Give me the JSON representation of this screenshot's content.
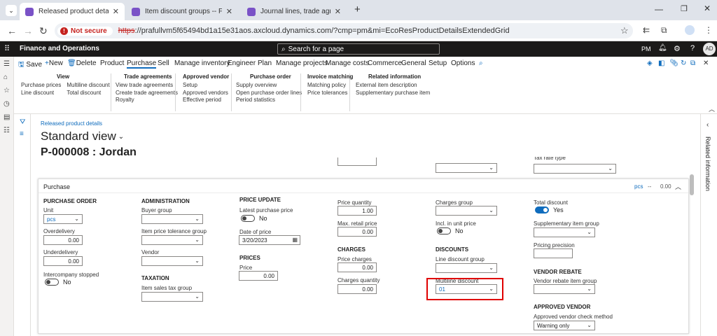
{
  "browser": {
    "tabs": [
      {
        "title": "Released product details -- Finance"
      },
      {
        "title": "Item discount groups -- Finance"
      },
      {
        "title": "Journal lines, trade agreement"
      }
    ],
    "new_tab": "+",
    "not_secure": "Not secure",
    "url_scheme": "https",
    "url_rest": "://prafullvm5f65494bd1a15e31aos.axcloud.dynamics.com/?cmp=pm&mi=EcoResProductDetailsExtendedGrid"
  },
  "app": {
    "title": "Finance and Operations",
    "search_placeholder": "Search for a page",
    "company": "PM",
    "avatar": "AD"
  },
  "commands": {
    "save": "Save",
    "new": "New",
    "delete": "Delete",
    "tabs": [
      "Product",
      "Purchase",
      "Sell",
      "Manage inventory",
      "Engineer",
      "Plan",
      "Manage projects",
      "Manage costs",
      "Commerce",
      "General",
      "Setup",
      "Options"
    ]
  },
  "ribbon": {
    "view": {
      "title": "View",
      "col1": [
        "Purchase prices",
        "Line discount"
      ],
      "col2": [
        "Multiline discount",
        "Total discount"
      ]
    },
    "trade": {
      "title": "Trade agreements",
      "items": [
        "View trade agreements",
        "Create trade agreements",
        "Royalty"
      ]
    },
    "vendor": {
      "title": "Approved vendor",
      "items": [
        "Setup",
        "Approved vendors",
        "Effective period"
      ]
    },
    "order": {
      "title": "Purchase order",
      "items": [
        "Supply overview",
        "Open purchase order lines",
        "Period statistics"
      ]
    },
    "matching": {
      "title": "Invoice matching",
      "items": [
        "Matching policy",
        "Price tolerances"
      ]
    },
    "related": {
      "title": "Related information",
      "items": [
        "External item description",
        "Supplementary purchase item"
      ]
    }
  },
  "page": {
    "breadcrumb": "Released product details",
    "view_name": "Standard view",
    "record_title": "P-000008 : Jordan",
    "related_pane": "Related information",
    "partial_label": "Tax rate type"
  },
  "purchase": {
    "title": "Purchase",
    "summary_unit": "pcs",
    "summary_sep": "--",
    "summary_price": "0.00",
    "purchase_order": {
      "section": "PURCHASE ORDER",
      "unit_label": "Unit",
      "unit_value": "pcs",
      "overdelivery_label": "Overdelivery",
      "overdelivery_value": "0.00",
      "underdelivery_label": "Underdelivery",
      "underdelivery_value": "0.00",
      "intercompany_label": "Intercompany stopped",
      "intercompany_value": "No"
    },
    "administration": {
      "section": "ADMINISTRATION",
      "buyer_group_label": "Buyer group",
      "tolerance_label": "Item price tolerance group",
      "vendor_label": "Vendor"
    },
    "taxation": {
      "section": "TAXATION",
      "sales_tax_label": "Item sales tax group"
    },
    "price_update": {
      "section": "PRICE UPDATE",
      "latest_label": "Latest purchase price",
      "latest_value": "No",
      "date_label": "Date of price",
      "date_value": "3/20/2023"
    },
    "prices": {
      "section": "PRICES",
      "price_label": "Price",
      "price_value": "0.00"
    },
    "quantity": {
      "price_qty_label": "Price quantity",
      "price_qty_value": "1.00",
      "max_retail_label": "Max. retail price",
      "max_retail_value": "0.00"
    },
    "charges": {
      "section": "CHARGES",
      "price_charges_label": "Price charges",
      "price_charges_value": "0.00",
      "charges_qty_label": "Charges quantity",
      "charges_qty_value": "0.00"
    },
    "charges_group": {
      "label": "Charges group",
      "incl_label": "Incl. in unit price",
      "incl_value": "No"
    },
    "discounts": {
      "section": "DISCOUNTS",
      "line_label": "Line discount group",
      "multiline_label": "Multiline discount",
      "multiline_value": "01"
    },
    "total": {
      "label": "Total discount",
      "value": "Yes",
      "supp_label": "Supplementary item group",
      "precision_label": "Pricing precision"
    },
    "rebate": {
      "section": "VENDOR REBATE",
      "group_label": "Vendor rebate item group"
    },
    "approved": {
      "section": "APPROVED VENDOR",
      "method_label": "Approved vendor check method",
      "method_value": "Warning only"
    }
  },
  "colors": {
    "accent": "#0f6cbd",
    "highlight": "#e00000",
    "navbar": "#1b1a19"
  }
}
